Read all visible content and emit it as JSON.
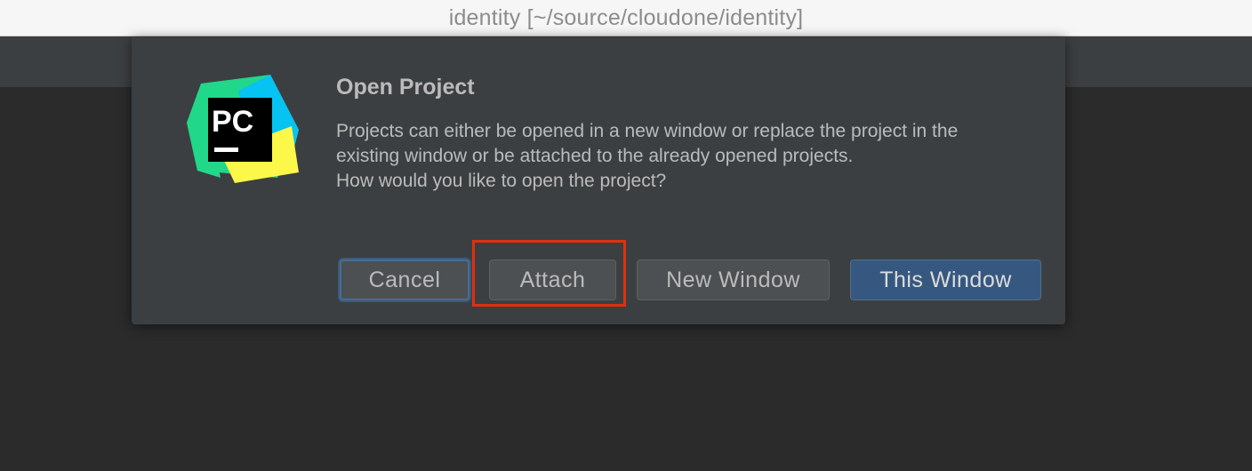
{
  "window": {
    "title": "identity [~/source/cloudone/identity]"
  },
  "dialog": {
    "title": "Open Project",
    "message_lines": [
      "Projects can either be opened in a new window or replace the project in the",
      "existing window or be attached to the already opened projects.",
      "How would you like to open the project?"
    ],
    "logo": {
      "icon": "pycharm-logo-icon",
      "text": "PC"
    },
    "buttons": {
      "cancel": "Cancel",
      "attach": "Attach",
      "new_window": "New Window",
      "this_window": "This Window"
    }
  },
  "colors": {
    "accent_primary_button": "#365880",
    "highlight_box": "#e0300f",
    "dialog_background": "#3c3f41"
  }
}
